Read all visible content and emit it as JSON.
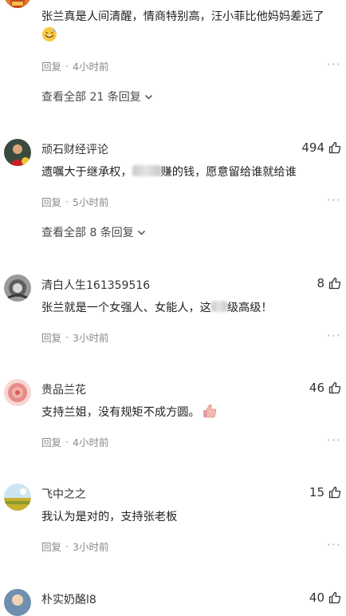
{
  "comments": [
    {
      "username": "",
      "text": "张兰真是人间清醒，情商特别高，汪小菲比他妈妈差远了",
      "emoji": "grin-sweat-emoji",
      "reply_label": "回复",
      "time": "4小时前",
      "view_all": "查看全部 21 条回复"
    },
    {
      "username": "顽石财经评论",
      "likes": "494",
      "text_before": "遗嘱大于继承权，",
      "text_after": "赚的钱，愿意留给谁就给谁",
      "reply_label": "回复",
      "time": "5小时前",
      "view_all": "查看全部 8 条回复"
    },
    {
      "username": "清白人生161359516",
      "likes": "8",
      "text_before": "张兰就是一个女强人、女能人，这",
      "text_after": "级高级！",
      "reply_label": "回复",
      "time": "3小时前"
    },
    {
      "username": "贵品兰花",
      "likes": "46",
      "text": "支持兰姐，没有规矩不成方圆。",
      "emoji": "thumbs-up-emoji",
      "reply_label": "回复",
      "time": "4小时前"
    },
    {
      "username": "飞中之之",
      "likes": "15",
      "text": "我认为是对的，支持张老板",
      "reply_label": "回复",
      "time": "3小时前"
    },
    {
      "username": "朴实奶酪l8",
      "likes": "40"
    }
  ],
  "separator_dot": "·",
  "more_glyph": "···",
  "colors": {
    "meta": "#8a8a8a",
    "text": "#222222",
    "accent_blur": "#c9c9c9"
  }
}
